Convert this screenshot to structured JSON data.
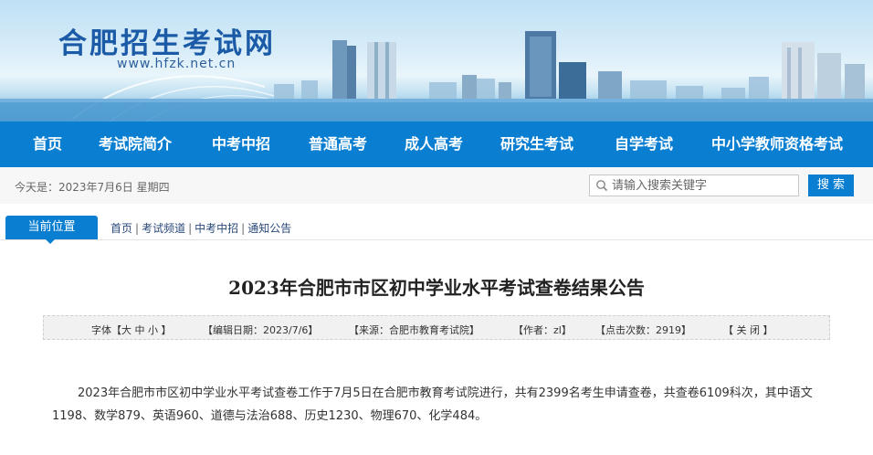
{
  "site": {
    "title": "合肥招生考试网",
    "url": "www.hfzk.net.cn"
  },
  "nav": {
    "items": [
      "首页",
      "考试院简介",
      "中考中招",
      "普通高考",
      "成人高考",
      "研究生考试",
      "自学考试",
      "中小学教师资格考试"
    ]
  },
  "infobar": {
    "today": "今天是：2023年7月6日 星期四",
    "search_placeholder": "请输入搜索关键字",
    "search_button": "搜 索"
  },
  "breadcrumb": {
    "tag": "当前位置",
    "items": [
      "首页",
      "考试频道",
      "中考中招",
      "通知公告"
    ],
    "separator": "|"
  },
  "article": {
    "title": "2023年合肥市市区初中学业水平考试查卷结果公告",
    "meta": {
      "font_size": "字体【大 中 小 】",
      "edit_date": "【编辑日期：2023/7/6】",
      "source": "【来源：合肥市教育考试院】",
      "author": "【作者：zl】",
      "clicks": "【点击次数：2919】",
      "close": "【 关 闭 】"
    },
    "body": "2023年合肥市市区初中学业水平考试查卷工作于7月5日在合肥市教育考试院进行，共有2399名考生申请查卷，共查卷6109科次，其中语文1198、数学879、英语960、道德与法治688、历史1230、物理670、化学484。"
  },
  "colors": {
    "nav": "#0a7fd2",
    "logo": "#1a5aa6",
    "accent": "#0a7fd2"
  }
}
